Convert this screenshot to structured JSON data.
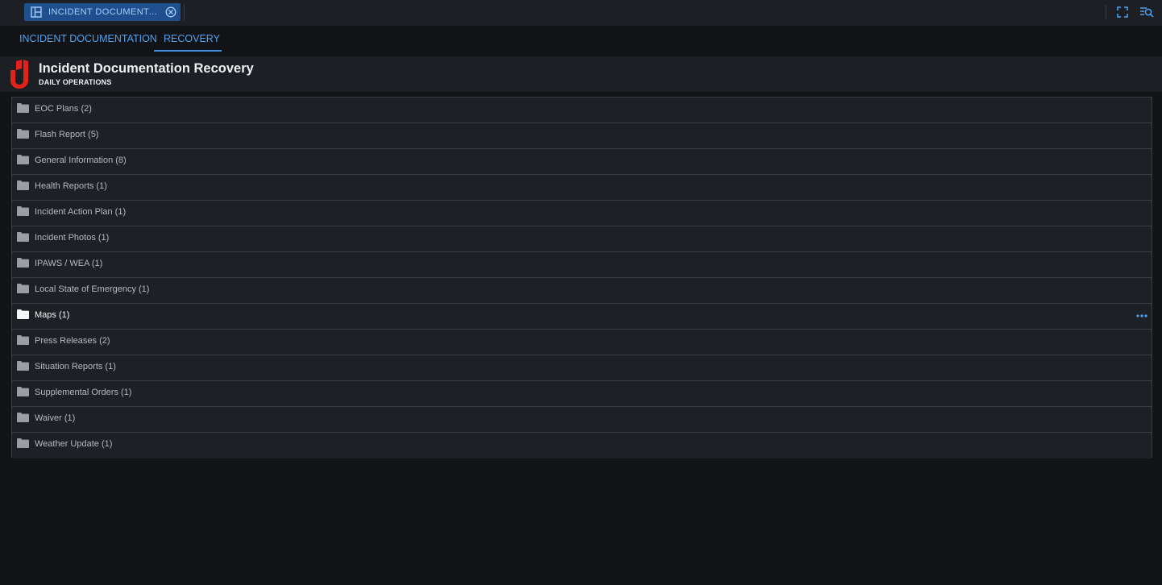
{
  "topbar": {
    "tab_label": "INCIDENT DOCUMENTATI...",
    "tab_icon": "dashboard-layout-icon",
    "close_icon": "close-circle-icon",
    "expand_icon": "fullscreen-icon",
    "search_icon": "search-list-icon"
  },
  "subnav": {
    "items": [
      {
        "label": "INCIDENT DOCUMENTATION"
      },
      {
        "label": "RECOVERY",
        "active": true
      }
    ]
  },
  "header": {
    "logo": "shield-logo",
    "title": "Incident Documentation Recovery",
    "subtitle": "DAILY OPERATIONS"
  },
  "folders": [
    {
      "label": "EOC Plans  (2)"
    },
    {
      "label": "Flash Report  (5)"
    },
    {
      "label": "General Information  (8)"
    },
    {
      "label": "Health Reports  (1)"
    },
    {
      "label": "Incident Action Plan  (1)"
    },
    {
      "label": "Incident Photos  (1)"
    },
    {
      "label": "IPAWS / WEA  (1)"
    },
    {
      "label": "Local State of Emergency  (1)"
    },
    {
      "label": "Maps  (1)",
      "hovered": true
    },
    {
      "label": "Press Releases  (2)"
    },
    {
      "label": "Situation Reports  (1)"
    },
    {
      "label": "Supplemental Orders  (1)"
    },
    {
      "label": "Waiver  (1)"
    },
    {
      "label": "Weather Update  (1)"
    }
  ],
  "colors": {
    "accent": "#4ea3f2",
    "logo_red": "#e2231a",
    "background": "#111316"
  }
}
